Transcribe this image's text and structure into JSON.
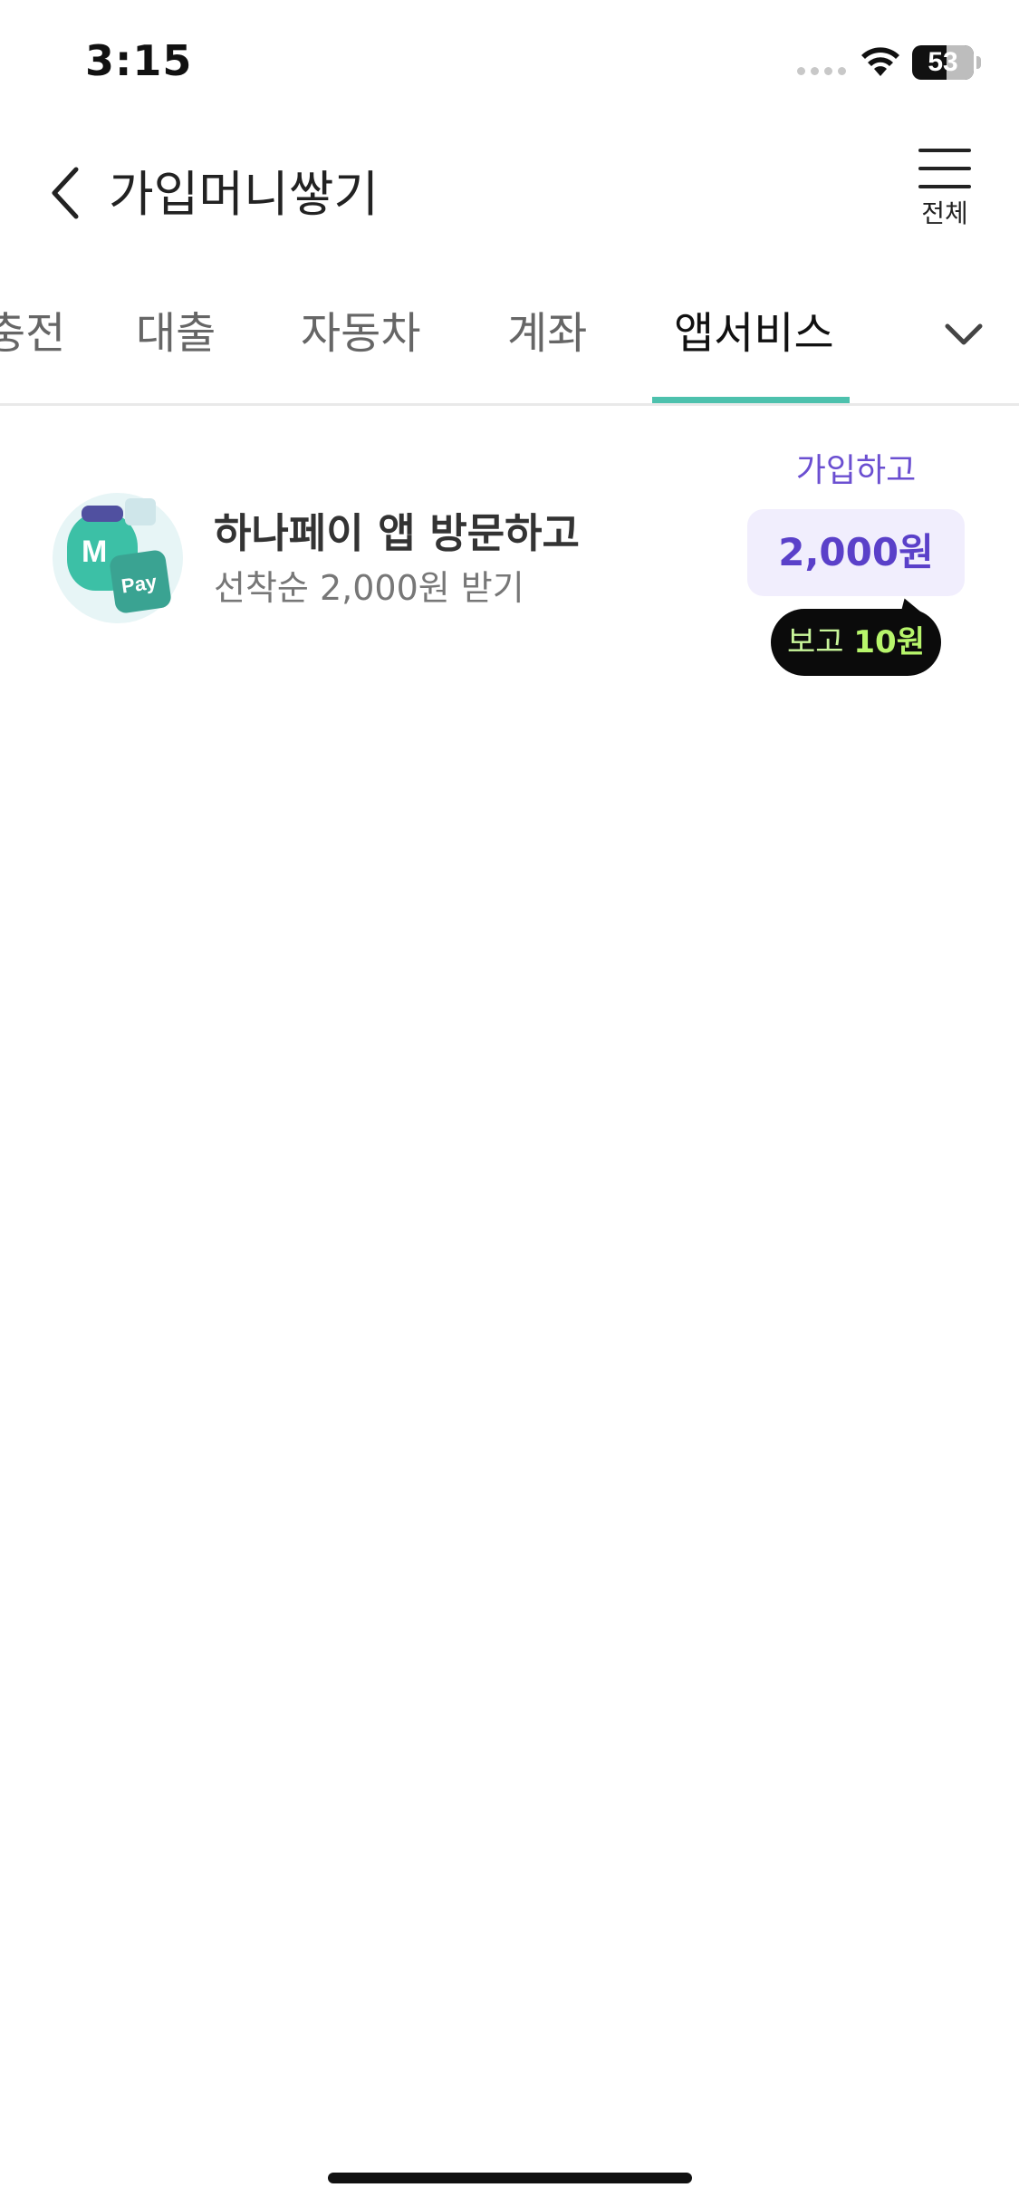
{
  "status_bar": {
    "time": "3:15",
    "battery": "53"
  },
  "header": {
    "title": "가입머니쌓기",
    "menu_label": "전체"
  },
  "tabs": {
    "items": [
      {
        "label": "충전"
      },
      {
        "label": "대출"
      },
      {
        "label": "자동차"
      },
      {
        "label": "계좌"
      },
      {
        "label": "앱서비스"
      }
    ],
    "active_index": 4
  },
  "offer": {
    "title": "하나페이 앱 방문하고",
    "subtitle": "선착순 2,000원 받기",
    "reward_caption": "가입하고",
    "reward_amount": "2,000원",
    "bubble_prefix": "보고 ",
    "bubble_amount": "10원"
  },
  "thumbnail": {
    "badge_letter": "M",
    "brand_text": "Pay"
  },
  "colors": {
    "accent": "#4dc1ad",
    "reward_text": "#5a40c9",
    "reward_bg": "#f1eefd"
  }
}
